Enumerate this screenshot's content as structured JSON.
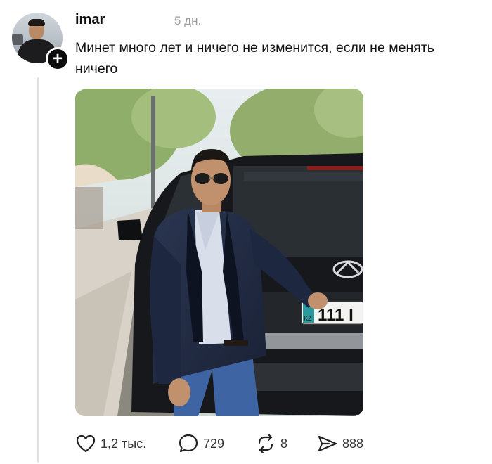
{
  "post": {
    "username": "imar",
    "timestamp": "5 дн.",
    "text": "Минет много лет и ничего не изменится, если не менять ничего"
  },
  "photo": {
    "plate_country": "KZ",
    "plate_number": "111 I"
  },
  "actions": {
    "likes": "1,2 тыс.",
    "replies": "729",
    "reposts": "8",
    "shares": "888"
  },
  "icons": {
    "follow": "plus-icon",
    "like": "heart-icon",
    "reply": "speech-bubble-icon",
    "repost": "repost-arrows-icon",
    "share": "send-arrow-icon"
  }
}
